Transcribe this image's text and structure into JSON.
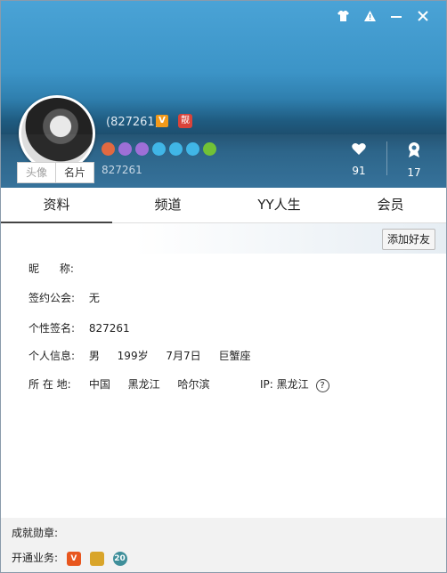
{
  "header": {
    "uid_paren": "(827261)",
    "uid": "827261",
    "badge_v": "V",
    "badge_red": "靓",
    "tabs": [
      "头像",
      "名片"
    ],
    "stats": [
      {
        "icon": "heart-icon",
        "value": "91"
      },
      {
        "icon": "medal-icon",
        "value": "17"
      }
    ],
    "medal_colors": [
      "#e0633a",
      "#9b6ad6",
      "#9b6ad6",
      "#39b3e6",
      "#39b3e6",
      "#39b3e6",
      "#6cbf2e"
    ]
  },
  "tabs": [
    "资料",
    "频道",
    "YY人生",
    "会员"
  ],
  "add_friend": "添加好友",
  "profile": {
    "nickname_label": "昵      称:",
    "nickname": "",
    "guild_label": "签约公会:",
    "guild": "无",
    "signature_label": "个性签名:",
    "signature": "827261",
    "personal_label": "个人信息:",
    "gender": "男",
    "age": "199岁",
    "birthday": "7月7日",
    "zodiac": "巨蟹座",
    "location_label": "所 在 地:",
    "country": "中国",
    "province": "黑龙江",
    "city": "哈尔滨",
    "ip_label": "IP:",
    "ip_loc": "黑龙江",
    "help": "?"
  },
  "footer": {
    "achievements_label": "成就勋章:",
    "services_label": "开通业务:",
    "services": [
      {
        "text": "V",
        "color": "#e8561e"
      },
      {
        "text": "",
        "color": "#d9a52a"
      },
      {
        "text": "20",
        "color": "#3f8f9a"
      }
    ]
  }
}
